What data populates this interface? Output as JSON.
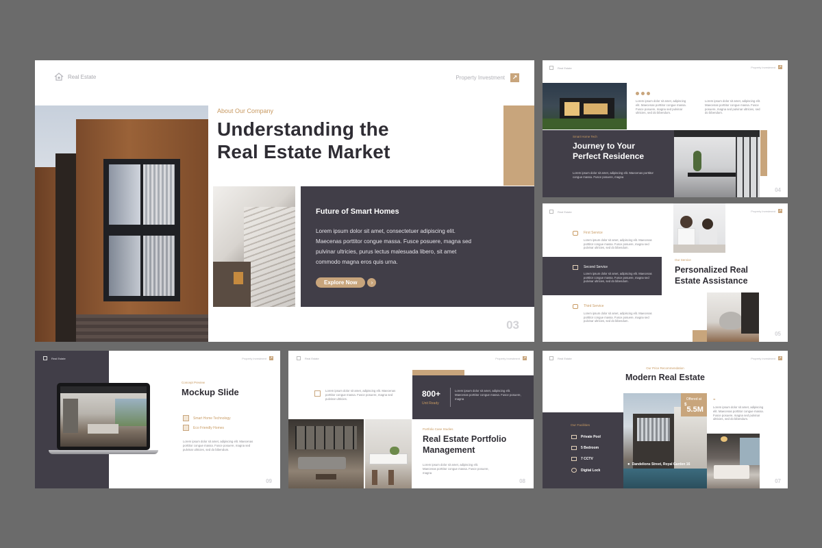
{
  "common": {
    "brand": "Real Estate",
    "nav": "Property Investment",
    "lorem_short": "Lorem ipsum dolor sit amet, adipiscing elit. Maecenas porttitor congue massa. Fusce posuere, magna sed pulvinar ultricies, sed do bibendum.",
    "lorem_mid": "Lorem ipsum dolor sit amet, adipiscing elit. Maecenas porttitor congue massa. Fusce posuere, magna sed pulvinar ultricies.",
    "lorem_2line": "Lorem ipsum dolor sit amet, adipiscing elit. Maecenas porttitor congue massa. Fusce posuere, magna"
  },
  "slide03": {
    "eyebrow": "About Our Company",
    "title_line1": "Understanding the",
    "title_line2": "Real Estate Market",
    "card_title": "Future of Smart Homes",
    "card_body": "Lorem ipsum dolor sit amet, consectetuer adipiscing elit. Maecenas porttitor congue massa. Fusce posuere, magna sed pulvinar ultricies, purus lectus malesuada libero, sit amet commodo magna eros quis urna.",
    "button": "Explore Now",
    "page": "03"
  },
  "slide04": {
    "eyebrow": "Smart Home Tech",
    "title_line1": "Journey to Your",
    "title_line2": "Perfect Residence",
    "page": "04"
  },
  "slide05": {
    "services": [
      {
        "label": "First Service"
      },
      {
        "label": "Second Service"
      },
      {
        "label": "Third Service"
      }
    ],
    "eyebrow": "Our Service",
    "title_line1": "Personalized Real",
    "title_line2": "Estate Assistance",
    "page": "05"
  },
  "slide09": {
    "eyebrow": "Concept Preview",
    "title": "Mockup Slide",
    "items": [
      "Smart Home Technology",
      "Eco Friendly Homes"
    ],
    "page": "09"
  },
  "slide08": {
    "stat_value": "800+",
    "stat_label": "Unit Ready",
    "eyebrow": "Portfolio Case Studies",
    "title_line1": "Real Estate Portfolio",
    "title_line2": "Management",
    "page": "08"
  },
  "slide07": {
    "eyebrow": "Our Price Recommendation",
    "title": "Modern Real Estate",
    "facilities_title": "Our Facilities",
    "facilities": [
      "Private Pool",
      "5 Bedroom",
      "7 CCTV",
      "Digital Lock"
    ],
    "offer_label": "Offered at",
    "offer_currency": "$",
    "offer_value": "5.5M",
    "address": "Dandelions Street, Royal Garden 16",
    "page": "07"
  },
  "colors": {
    "dark": "#413e48",
    "gold": "#c8a57c",
    "background": "#6b6b6b"
  }
}
